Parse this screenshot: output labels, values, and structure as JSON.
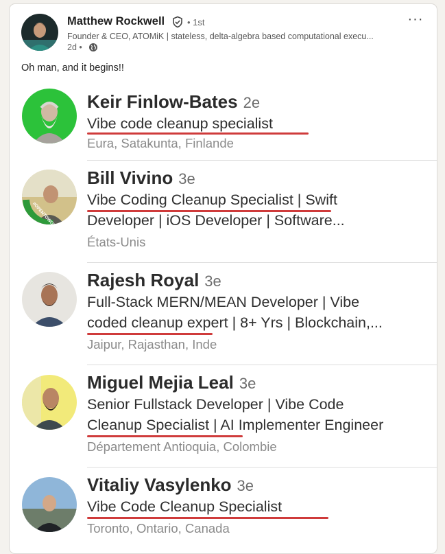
{
  "post": {
    "author_name": "Matthew Rockwell",
    "degree": "• 1st",
    "headline": "Founder & CEO, ATOMiK | stateless, delta-algebra based computational execu...",
    "time": "2d •",
    "more_label": "···",
    "text": "Oh man, and it begins!!"
  },
  "embedded_results": [
    {
      "name": "Keir Finlow-Bates",
      "degree": "2e",
      "line1": "Vibe code cleanup specialist",
      "line2": "",
      "location": "Eura, Satakunta, Finlande"
    },
    {
      "name": "Bill Vivino",
      "degree": "3e",
      "line1": "Vibe Coding Cleanup Specialist | Swift",
      "line2": "Developer | iOS Developer | Software...",
      "location": "États-Unis",
      "badge_text": "#OPENTOWORK"
    },
    {
      "name": "Rajesh Royal",
      "degree": "3e",
      "line1": "Full-Stack MERN/MEAN Developer | Vibe",
      "line2": "coded cleanup expert | 8+ Yrs | Blockchain,...",
      "location": "Jaipur, Rajasthan, Inde"
    },
    {
      "name": "Miguel Mejia Leal",
      "degree": "3e",
      "line1": "Senior Fullstack Developer | Vibe Code",
      "line2": "Cleanup Specialist | AI Implementer Engineer",
      "location": "Département Antioquia, Colombie"
    },
    {
      "name": "Vitaliy Vasylenko",
      "degree": "3e",
      "line1": "Vibe Code Cleanup Specialist",
      "line2": "",
      "location": "Toronto, Ontario, Canada"
    }
  ],
  "colors": {
    "underline": "#cf3b3b",
    "verified": "#444444"
  }
}
